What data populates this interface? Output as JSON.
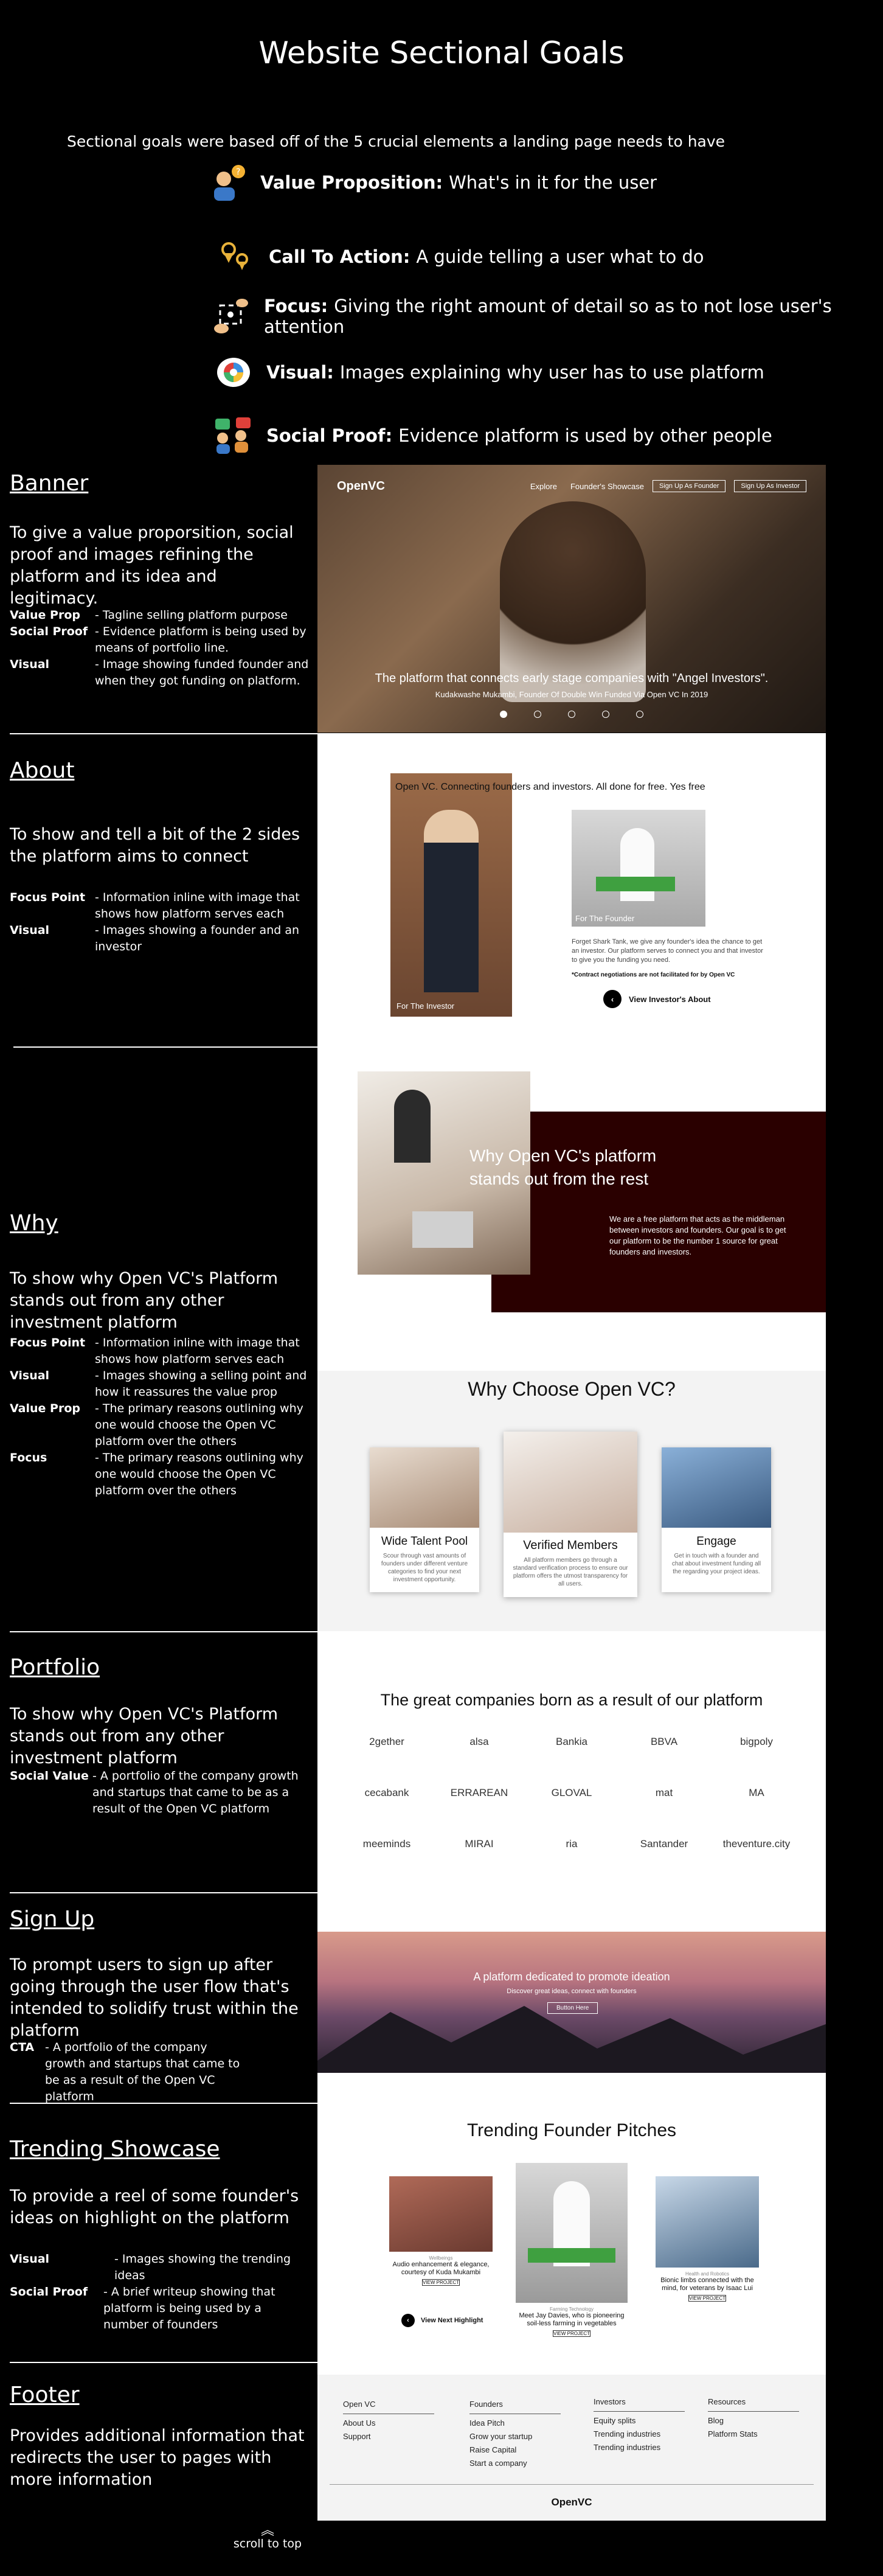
{
  "title": "Website Sectional Goals",
  "intro": "Sectional goals were based off of the 5 crucial elements a landing page needs to have",
  "goals": [
    {
      "icon": "person-question-icon",
      "name": "Value Proposition:",
      "desc": "What's in it for the user"
    },
    {
      "icon": "location-pins-icon",
      "name": "Call To Action:",
      "desc": "A guide telling a user what to do"
    },
    {
      "icon": "focus-hand-icon",
      "name": "Focus:",
      "desc": "Giving the right amount of detail so as to not lose user's attention"
    },
    {
      "icon": "eye-icon",
      "name": "Visual:",
      "desc": "Images explaining why user has to use platform"
    },
    {
      "icon": "people-chat-icon",
      "name": "Social Proof:",
      "desc": "Evidence platform is used by other people"
    }
  ],
  "sections": {
    "banner": {
      "heading": "Banner",
      "text": "To give a value proporsition, social proof and images refining the platform and its idea and legitimacy.",
      "items": [
        {
          "k": "Value Prop",
          "v": "- Tagline selling platform purpose"
        },
        {
          "k": "Social Proof",
          "v": "- Evidence platform is being used by means of portfolio line."
        },
        {
          "k": "Visual",
          "v": "- Image showing funded founder and when they got funding on platform."
        }
      ]
    },
    "about": {
      "heading": "About",
      "text": "To show and tell a bit of the 2 sides the platform aims to connect",
      "items": [
        {
          "k": "Focus Point",
          "v": "- Information inline with image that shows how platform serves each"
        },
        {
          "k": "Visual",
          "v": "- Images showing a founder and an investor"
        }
      ]
    },
    "why": {
      "heading": "Why",
      "text": "To show why Open VC's Platform stands out from any other investment platform",
      "items": [
        {
          "k": "Focus Point",
          "v": "- Information inline with image that shows how platform serves each"
        },
        {
          "k": "Visual",
          "v": "- Images showing a selling point and how it reassures the value prop"
        },
        {
          "k": "Value Prop",
          "v": "- The primary reasons outlining why one would choose the Open VC platform over the others"
        },
        {
          "k": "Focus",
          "v": "- The primary reasons outlining why one would choose the Open VC platform over the others"
        }
      ]
    },
    "portfolio": {
      "heading": "Portfolio",
      "text": "To show why Open VC's Platform stands out from any other investment platform",
      "items": [
        {
          "k": "Social Value",
          "v": "- A portfolio of the company growth and startups that came to be as a result of the Open VC platform"
        }
      ]
    },
    "signup": {
      "heading": "Sign Up",
      "text": "To prompt users to sign up after going through the user flow that's intended to solidify trust within the platform",
      "items": [
        {
          "k": "CTA",
          "v": "- A portfolio of the company growth and startups that came to be as a result of the Open VC platform"
        }
      ]
    },
    "trending": {
      "heading": "Trending Showcase",
      "text": "To provide a reel of some founder's ideas on highlight on the platform",
      "items": [
        {
          "k": "Visual",
          "v": "- Images showing the trending ideas"
        },
        {
          "k": "Social Proof",
          "v": "- A brief writeup showing that platform is being used by a number of founders"
        }
      ]
    },
    "footer": {
      "heading": "Footer",
      "text": "Provides additional information that redirects the user to pages with more information"
    }
  },
  "mock": {
    "banner": {
      "logo": "OpenVC",
      "nav": [
        "Explore",
        "Founder's Showcase"
      ],
      "btn_founder": "Sign Up As Founder",
      "btn_investor": "Sign Up As Investor",
      "tagline": "The platform that connects early stage companies with \"Angel Investors\".",
      "caption": "Kudakwashe Mukambi, Founder Of Double Win Funded Via Open VC In 2019"
    },
    "about": {
      "headline": "Open VC. Connecting founders and investors. All done for free. Yes free",
      "investor_label": "For The Investor",
      "founder_label": "For The Founder",
      "founder_text": "Forget Shark Tank, we give any founder's idea the chance to get an investor. Our platform serves to connect you and that investor to give you the funding you need.",
      "disclaimer": "*Contract negotiations are not facilitated for by Open VC",
      "link": "View Investor's About"
    },
    "why": {
      "headline": "Why Open VC's platform stands out from the rest",
      "text": "We are a free platform that acts as the middleman between investors and founders. Our goal is to get our platform to be the number 1 source for great founders and investors."
    },
    "choose": {
      "title": "Why Choose Open VC?",
      "cards": [
        {
          "title": "Wide Talent Pool",
          "text": "Scour through vast amounts of founders under different venture categories to find your next investment opportunity."
        },
        {
          "title": "Verified Members",
          "text": "All platform members go through a standard verification process to ensure our platform offers the utmost transparency for all users."
        },
        {
          "title": "Engage",
          "text": "Get in touch with a founder and chat about investment funding all the regarding your project ideas."
        }
      ]
    },
    "portfolio": {
      "title": "The great companies born as a result of our platform",
      "logos": [
        "2gether",
        "alsa",
        "Bankia",
        "BBVA",
        "bigpoly",
        "cecabank",
        "ERRAREAN",
        "GLOVAL",
        "mat",
        "MA",
        "meeminds",
        "MIRAI",
        "ria",
        "Santander",
        "theventure.city"
      ]
    },
    "signup": {
      "headline": "A platform dedicated to promote ideation",
      "sub": "Discover great ideas, connect with founders",
      "button": "Button Here"
    },
    "trending": {
      "title": "Trending Founder Pitches",
      "cards": [
        {
          "category": "Wellbeings",
          "title": "Audio enhancement & elegance, courtesy of Kuda Mukambi",
          "button": "VIEW PROJECT"
        },
        {
          "category": "Farming Technology",
          "title": "Meet Jay Davies, who is pioneering soil-less farming in vegetables",
          "button": "VIEW PROJECT"
        },
        {
          "category": "Health and Robotics",
          "title": "Bionic limbs connected with the mind, for veterans by Isaac Lui",
          "button": "VIEW PROJECT"
        }
      ],
      "link": "View Next Highlight"
    },
    "footer": {
      "columns": [
        {
          "heading": "Open VC",
          "links": [
            "About Us",
            "Support"
          ]
        },
        {
          "heading": "Founders",
          "links": [
            "Idea Pitch",
            "Grow your startup",
            "Raise Capital",
            "Start a company"
          ]
        },
        {
          "heading": "Investors",
          "links": [
            "Equity splits",
            "Trending industries",
            "Trending industries"
          ]
        },
        {
          "heading": "Resources",
          "links": [
            "Blog",
            "Platform Stats"
          ]
        }
      ],
      "logo": "OpenVC"
    }
  },
  "scroll_top": "scroll to top"
}
